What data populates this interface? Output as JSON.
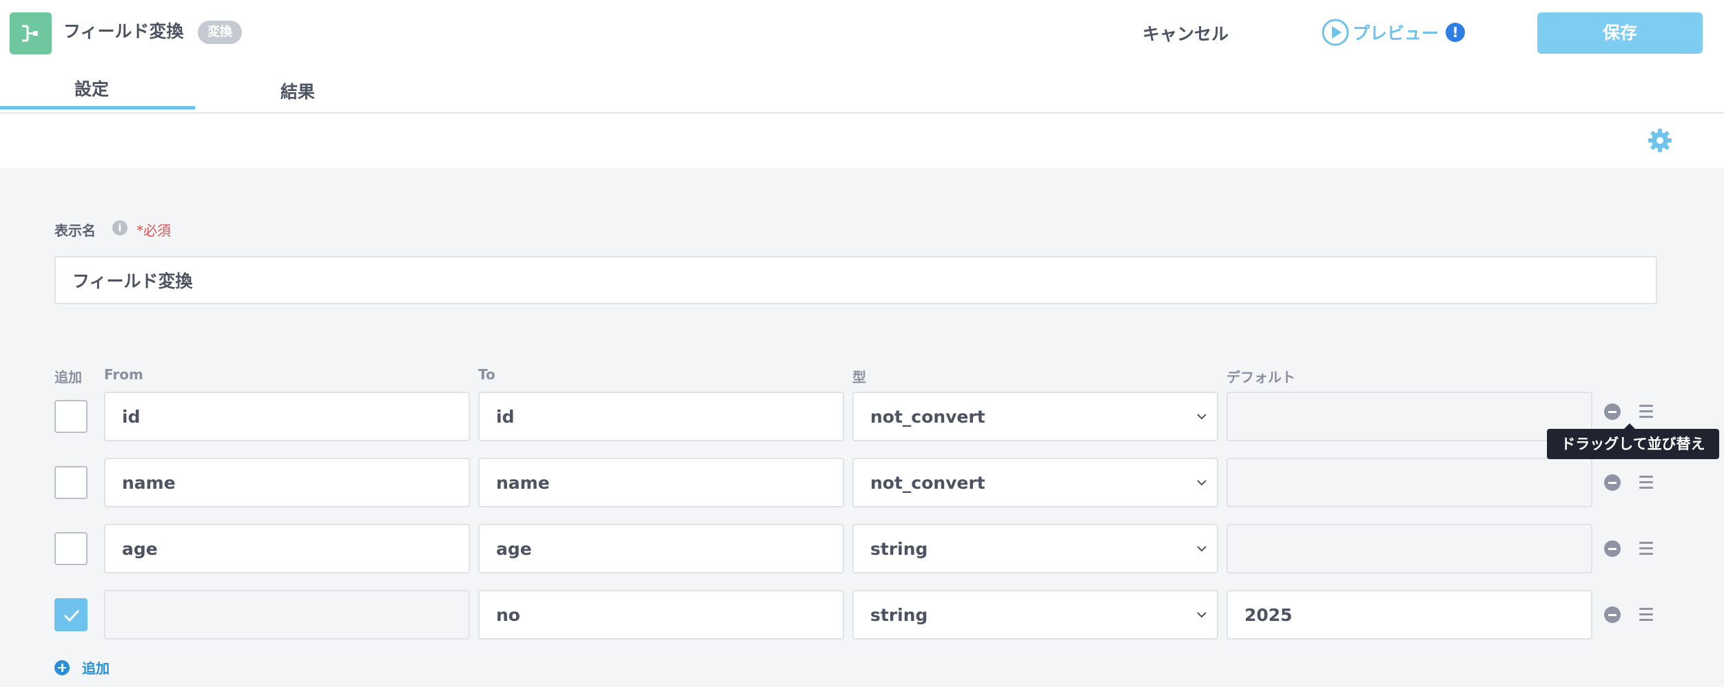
{
  "header": {
    "title": "フィールド変換",
    "badge": "変換",
    "cancel_label": "キャンセル",
    "preview_label": "プレビュー",
    "preview_alert": "!",
    "save_label": "保存"
  },
  "tabs": [
    {
      "label": "設定",
      "active": true
    },
    {
      "label": "結果",
      "active": false
    }
  ],
  "form": {
    "display_name_label": "表示名",
    "info_glyph": "i",
    "required_label": "*必須",
    "display_name_value": "フィールド変換"
  },
  "table": {
    "headers": {
      "add": "追加",
      "from": "From",
      "to": "To",
      "type": "型",
      "default": "デフォルト"
    },
    "rows": [
      {
        "checked": false,
        "from": "id",
        "to": "id",
        "type": "not_convert",
        "default": ""
      },
      {
        "checked": false,
        "from": "name",
        "to": "name",
        "type": "not_convert",
        "default": ""
      },
      {
        "checked": false,
        "from": "age",
        "to": "age",
        "type": "string",
        "default": ""
      },
      {
        "checked": true,
        "from": "",
        "to": "no",
        "type": "string",
        "default": "2025"
      }
    ],
    "tooltip": "ドラッグして並び替え",
    "add_label": "追加"
  },
  "icons": [
    "flow-icon",
    "play-icon",
    "alert-icon",
    "gear-icon",
    "info-icon",
    "check-icon",
    "chevron-down-icon",
    "remove-icon",
    "drag-handle-icon",
    "plus-icon"
  ],
  "colors": {
    "accent": "#6ec3ee",
    "app_icon": "#6fc7a0",
    "required": "#e05252",
    "link": "#2a8fd6"
  }
}
